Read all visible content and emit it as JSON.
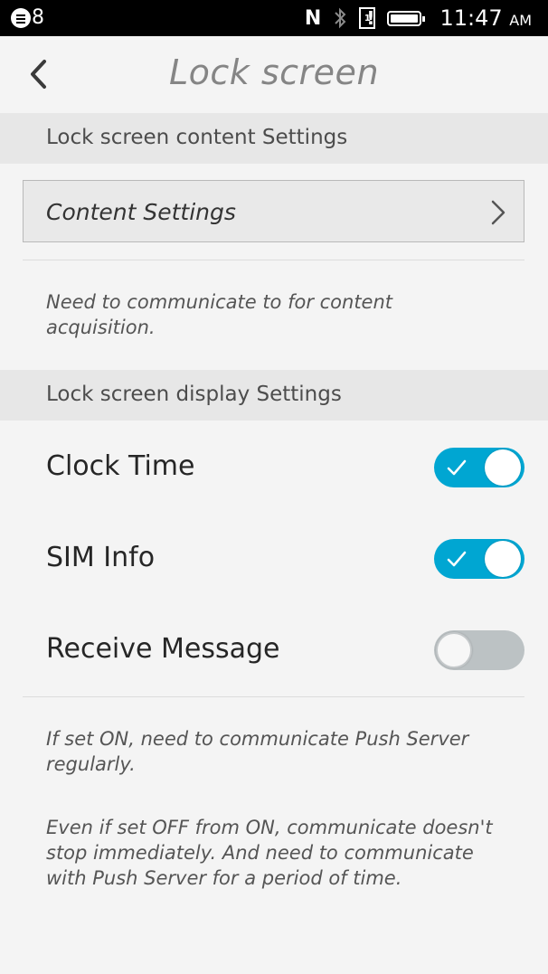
{
  "status_bar": {
    "notification_count": "8",
    "nfc_icon": "N",
    "bluetooth_icon": "bluetooth-icon",
    "time": "11:47",
    "ampm": "AM"
  },
  "header": {
    "title": "Lock screen",
    "back_icon": "chevron-left-icon"
  },
  "sections": {
    "content": {
      "title": "Lock screen content Settings",
      "button_label": "Content Settings",
      "note": "Need to communicate to for content acquisition."
    },
    "display": {
      "title": "Lock screen display Settings",
      "rows": [
        {
          "label": "Clock Time",
          "enabled": true
        },
        {
          "label": "SIM Info",
          "enabled": true
        },
        {
          "label": "Receive Message",
          "enabled": false
        }
      ],
      "note_1": "If set ON, need to communicate Push Server regularly.",
      "note_2": "Even if set OFF from ON, communicate doesn't stop immediately. And need to communicate with Push Server for a period of time."
    }
  },
  "colors": {
    "toggle_on": "#00a6d2",
    "toggle_off": "#bcc2c4",
    "section_bg": "#e7e7e7"
  }
}
